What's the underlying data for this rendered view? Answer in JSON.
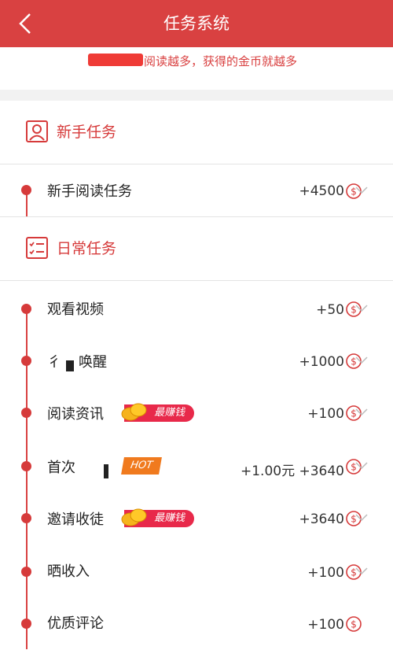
{
  "header": {
    "title": "任务系统"
  },
  "banner": {
    "text": "阅读越多，获得的金币就越多"
  },
  "sections": {
    "newbie": {
      "title": "新手任务"
    },
    "daily": {
      "title": "日常任务"
    }
  },
  "tasks": {
    "newbie_read": {
      "label": "新手阅读任务",
      "reward": "+4500"
    },
    "watch_video": {
      "label": "观看视频",
      "reward": "+50"
    },
    "wake_up": {
      "label_a": "彳",
      "label_b": "唤醒",
      "reward": "+1000"
    },
    "read_news": {
      "label": "阅读资讯",
      "badge": "最赚钱",
      "reward": "+100"
    },
    "first_time": {
      "label": "首次",
      "badge": "HOT",
      "reward": "+1.00元 +3640"
    },
    "invite": {
      "label": "邀请收徒",
      "badge": "最赚钱",
      "reward": "+3640"
    },
    "show_income": {
      "label": "晒收入",
      "reward": "+100"
    },
    "quality_review": {
      "label": "优质评论",
      "reward": "+100"
    }
  },
  "icons": {
    "back": "back-icon",
    "user": "user-icon",
    "checklist": "checklist-icon",
    "coin": "coin-icon",
    "chevron": "chevron-down-icon",
    "coins": "gold-coins-icon"
  },
  "colors": {
    "brand": "#d94141",
    "badge": "#e8294a",
    "hot": "#f07a1e"
  }
}
